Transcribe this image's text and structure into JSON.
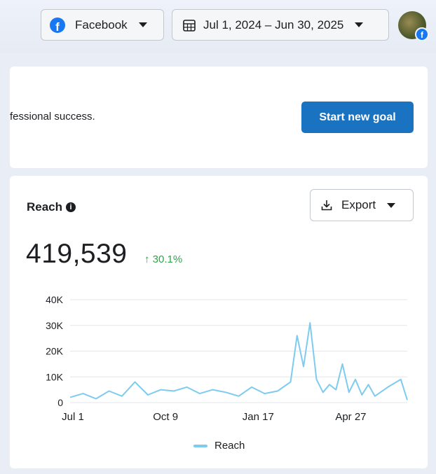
{
  "header": {
    "platform": {
      "label": "Facebook",
      "icon": "facebook-icon"
    },
    "date_range": {
      "label": "Jul 1, 2024 – Jun 30, 2025",
      "icon": "calendar-icon"
    },
    "avatar": {
      "icon": "profile-avatar"
    }
  },
  "goal_card": {
    "text": "fessional success.",
    "button_label": "Start new goal"
  },
  "reach_card": {
    "title": "Reach",
    "info_icon": "info-icon",
    "export_label": "Export",
    "export_icon": "download-icon",
    "total": "419,539",
    "change": "↑ 30.1%",
    "legend_label": "Reach"
  },
  "colors": {
    "accent": "#1a73c0",
    "line": "#7ecbf0",
    "positive": "#31a24c",
    "facebook": "#1877f2"
  },
  "chart_data": {
    "type": "line",
    "x_ticks": [
      "Jul 1",
      "Oct 9",
      "Jan 17",
      "Apr 27"
    ],
    "y_ticks": [
      "0",
      "10K",
      "20K",
      "30K",
      "40K"
    ],
    "ylim": [
      0,
      40000
    ],
    "grid": true,
    "legend": "bottom",
    "series": [
      {
        "name": "Reach",
        "x": [
          "2024-07-01",
          "2024-07-15",
          "2024-07-29",
          "2024-08-12",
          "2024-08-26",
          "2024-09-09",
          "2024-09-23",
          "2024-10-07",
          "2024-10-21",
          "2024-11-04",
          "2024-11-18",
          "2024-12-02",
          "2024-12-16",
          "2024-12-30",
          "2025-01-13",
          "2025-01-27",
          "2025-02-10",
          "2025-02-24",
          "2025-03-03",
          "2025-03-10",
          "2025-03-17",
          "2025-03-24",
          "2025-03-31",
          "2025-04-07",
          "2025-04-14",
          "2025-04-21",
          "2025-04-28",
          "2025-05-05",
          "2025-05-12",
          "2025-05-19",
          "2025-05-26",
          "2025-06-09",
          "2025-06-23",
          "2025-06-30"
        ],
        "values": [
          2000,
          3500,
          1500,
          4500,
          2500,
          8000,
          3000,
          5000,
          4500,
          6000,
          3500,
          5000,
          4000,
          2500,
          6000,
          3500,
          4500,
          8000,
          26000,
          14000,
          31000,
          9000,
          4000,
          7000,
          5000,
          15000,
          4000,
          9000,
          3000,
          7000,
          2500,
          6000,
          9000,
          1000
        ]
      }
    ]
  }
}
